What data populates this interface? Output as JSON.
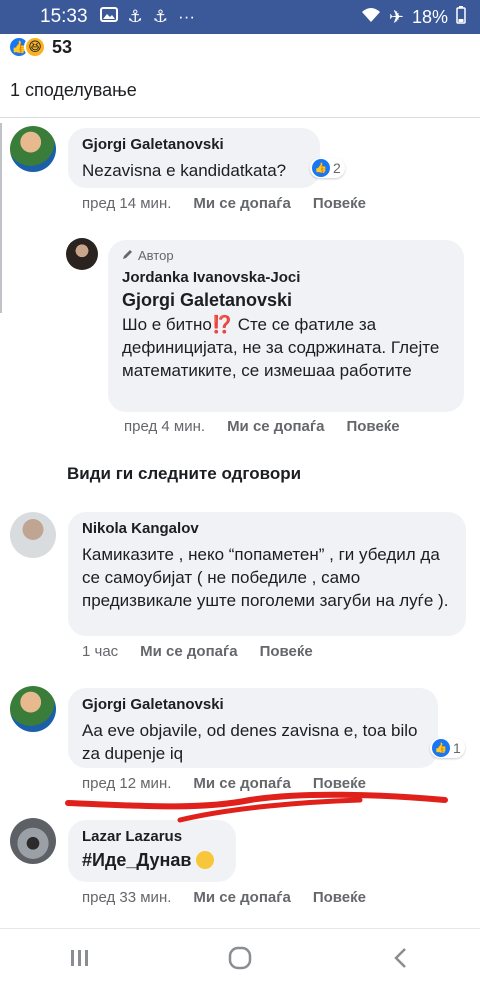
{
  "status_bar": {
    "time": "15:33",
    "battery": "18%",
    "more": "···"
  },
  "post": {
    "reaction_count": "53",
    "shares": "1 споделување"
  },
  "comments": [
    {
      "author": "Gjorgi Galetanovski",
      "text": "Nezavisna e kandidatkata?",
      "likes": "2",
      "time": "пред 14 мин.",
      "like_label": "Ми се допаѓа",
      "reply_label": "Повеќе"
    },
    {
      "author_badge": "Автор",
      "author": "Jordanka Ivanovska-Joci",
      "tag": "Gjorgi Galetanovski",
      "text": "Шо е битно⁉️ Сте се фатиле за дефиницијата, не за содржината. Глејте математиките, се измешаа работите",
      "time": "пред 4 мин.",
      "like_label": "Ми се допаѓа",
      "reply_label": "Повеќе"
    },
    {
      "author": "Nikola Kangalov",
      "text": "Камиказите , неко “попаметен” , ги убедил да се самоубијат ( не победиле , само предизвикале уште поголеми загуби на луѓе ).",
      "time": "1 час",
      "like_label": "Ми се допаѓа",
      "reply_label": "Повеќе"
    },
    {
      "author": "Gjorgi Galetanovski",
      "text": "Aa eve objavile, od denes zavisna e, toa bilo za dupenje iq",
      "likes": "1",
      "time": "пред 12 мин.",
      "like_label": "Ми се допаѓа",
      "reply_label": "Повеќе"
    },
    {
      "author": "Lazar Lazarus",
      "text": "#Иде_Дунав",
      "time": "пред 33 мин.",
      "like_label": "Ми се допаѓа",
      "reply_label": "Повеќе"
    }
  ],
  "more_replies": "Види ги следните одговори",
  "colors": {
    "header": "#3b5998",
    "like_blue": "#1877f2",
    "bubble": "#f0f2f5",
    "red_mark": "#e0201b"
  }
}
